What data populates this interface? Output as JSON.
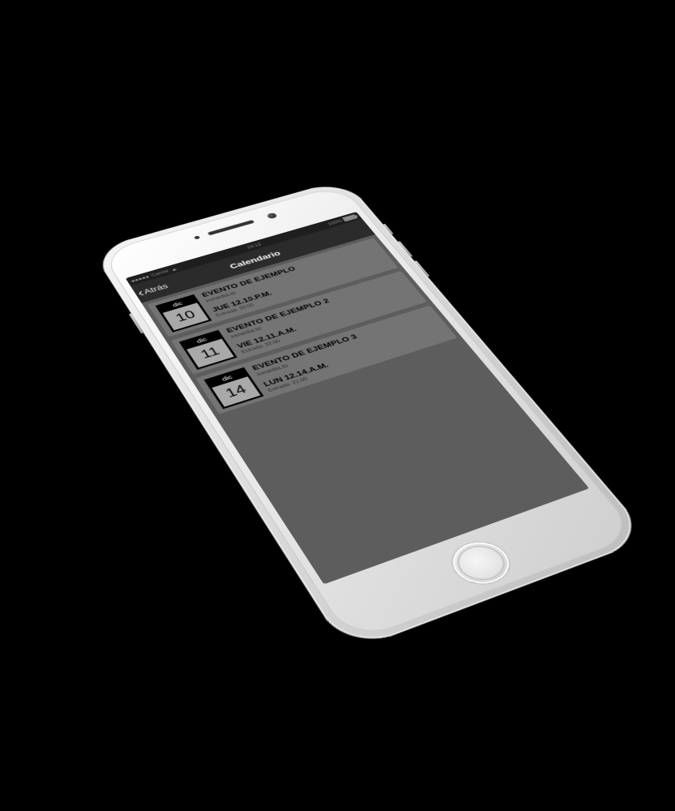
{
  "status": {
    "carrier": "Carrier",
    "time": "16:12",
    "battery": "100%"
  },
  "nav": {
    "back": "Atrás",
    "title": "Calendario"
  },
  "events": [
    {
      "month": "dic",
      "day": "10",
      "title": "EVENTO DE EJEMPLO",
      "sub": "inmedia.to",
      "when": "JUE 12.10.P.M.",
      "entry": "Entrada: 20:00"
    },
    {
      "month": "dic",
      "day": "11",
      "title": "EVENTO DE EJEMPLO 2",
      "sub": "inmedia.to",
      "when": "VIE 12.11.A.M.",
      "entry": "Entrada: 22:00"
    },
    {
      "month": "dic",
      "day": "14",
      "title": "EVENTO DE EJEMPLO 3",
      "sub": "inmedia.to",
      "when": "LUN 12.14.A.M.",
      "entry": "Entrada: 21:00"
    }
  ]
}
